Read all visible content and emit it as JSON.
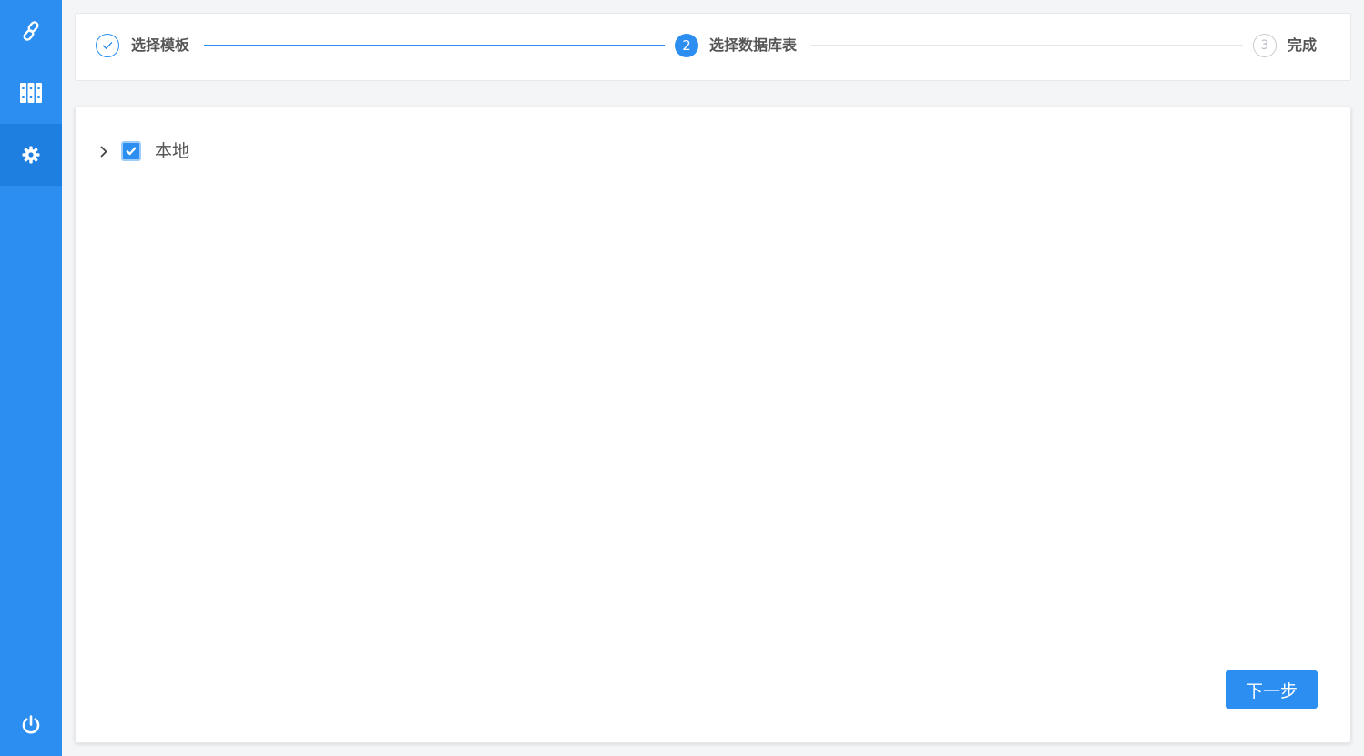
{
  "sidebar": {
    "items": [
      {
        "icon": "link-icon",
        "active": false
      },
      {
        "icon": "library-icon",
        "active": false
      },
      {
        "icon": "gear-icon",
        "active": true
      },
      {
        "icon": "power-icon",
        "active": false
      }
    ]
  },
  "steps": [
    {
      "number": "1",
      "title": "选择模板",
      "status": "done"
    },
    {
      "number": "2",
      "title": "选择数据库表",
      "status": "active"
    },
    {
      "number": "3",
      "title": "完成",
      "status": "todo"
    }
  ],
  "tree": {
    "nodes": [
      {
        "label": "本地",
        "checked": true,
        "expanded": false
      }
    ]
  },
  "actions": {
    "next_label": "下一步"
  },
  "colors": {
    "primary": "#2b8ef0",
    "sidebar_active": "#1f7fe0",
    "text": "#555555",
    "inactive": "#c8ccd2"
  }
}
